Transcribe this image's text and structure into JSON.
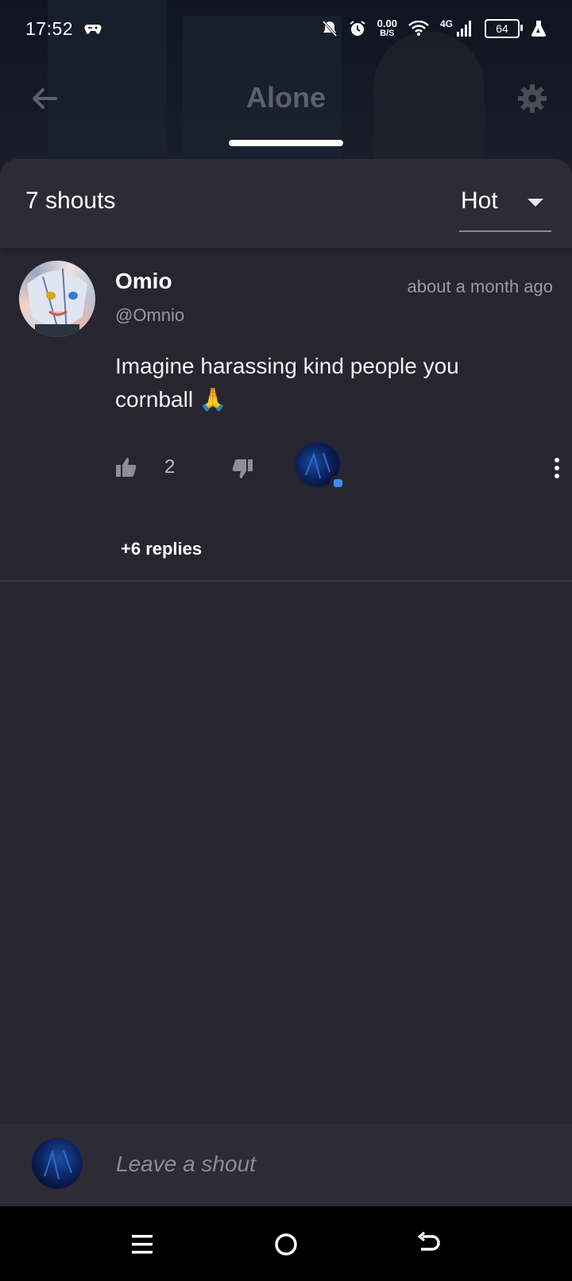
{
  "status_bar": {
    "time": "17:52",
    "net_speed_value": "0.00",
    "net_speed_unit": "B/S",
    "network": "4G",
    "battery": "64"
  },
  "header": {
    "title": "Alone"
  },
  "sheet": {
    "shout_count": "7 shouts",
    "sort_label": "Hot"
  },
  "shout": {
    "username": "Omio",
    "handle": "@Omnio",
    "time": "about a month ago",
    "text": "Imagine harassing kind people you cornball 🙏",
    "likes": "2",
    "replies_label": "+6 replies"
  },
  "composer": {
    "placeholder": "Leave a shout"
  },
  "colors": {
    "background": "#272530",
    "panel": "#2d2b36",
    "muted_text": "#9b99a3",
    "accent": "#3a8ff0"
  }
}
